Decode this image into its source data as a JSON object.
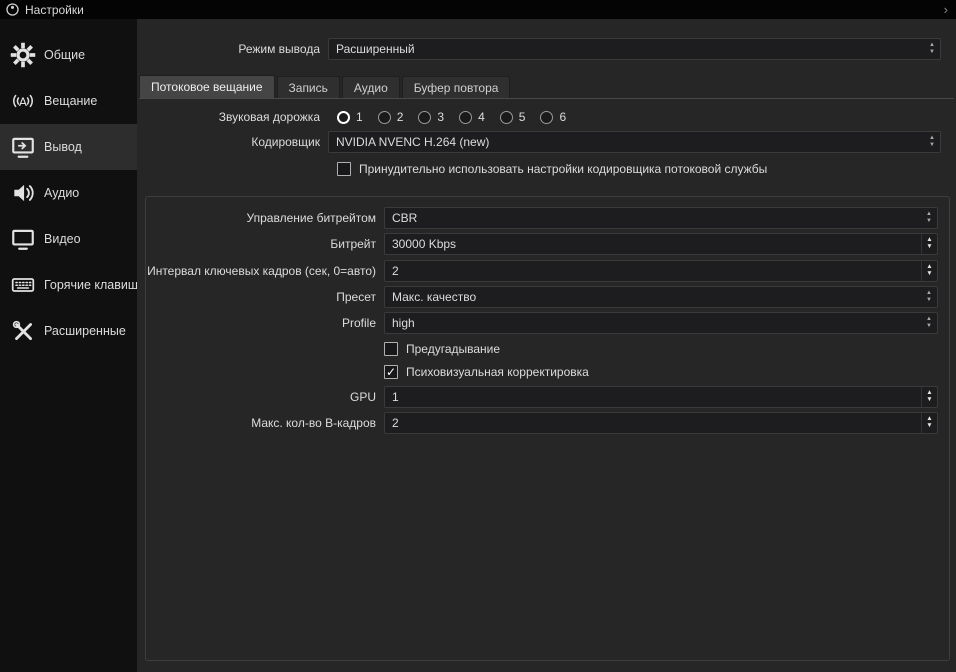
{
  "icons": {
    "up": "▲",
    "down": "▼",
    "check": "✓",
    "window_chevron": "›"
  },
  "titlebar": {
    "title": "Настройки"
  },
  "sidebar": {
    "items": [
      {
        "label": "Общие"
      },
      {
        "label": "Вещание"
      },
      {
        "label": "Вывод",
        "selected": true
      },
      {
        "label": "Аудио"
      },
      {
        "label": "Видео"
      },
      {
        "label": "Горячие клавиши"
      },
      {
        "label": "Расширенные"
      }
    ]
  },
  "output_mode": {
    "label": "Режим вывода",
    "value": "Расширенный"
  },
  "tabs": [
    {
      "label": "Потоковое вещание",
      "active": true
    },
    {
      "label": "Запись",
      "active": false
    },
    {
      "label": "Аудио",
      "active": false
    },
    {
      "label": "Буфер повтора",
      "active": false
    }
  ],
  "streaming": {
    "audio_track": {
      "label": "Звуковая дорожка",
      "options": [
        "1",
        "2",
        "3",
        "4",
        "5",
        "6"
      ],
      "selected": "1"
    },
    "encoder": {
      "label": "Кодировщик",
      "value": "NVIDIA NVENC H.264 (new)"
    },
    "enforce_service_settings": {
      "label": "Принудительно использовать настройки кодировщика потоковой службы",
      "checked": false
    },
    "encoder_settings": {
      "rate_control": {
        "label": "Управление битрейтом",
        "value": "CBR"
      },
      "bitrate": {
        "label": "Битрейт",
        "value": "30000 Kbps"
      },
      "keyframe_interval": {
        "label": "Интервал ключевых кадров (сек, 0=авто)",
        "value": "2"
      },
      "preset": {
        "label": "Пресет",
        "value": "Макс. качество"
      },
      "profile": {
        "label": "Profile",
        "value": "high"
      },
      "lookahead": {
        "label": "Предугадывание",
        "checked": false
      },
      "psycho_visual_tuning": {
        "label": "Психовизуальная корректировка",
        "checked": true
      },
      "gpu": {
        "label": "GPU",
        "value": "1"
      },
      "max_b_frames": {
        "label": "Макс. кол-во B-кадров",
        "value": "2"
      }
    }
  }
}
